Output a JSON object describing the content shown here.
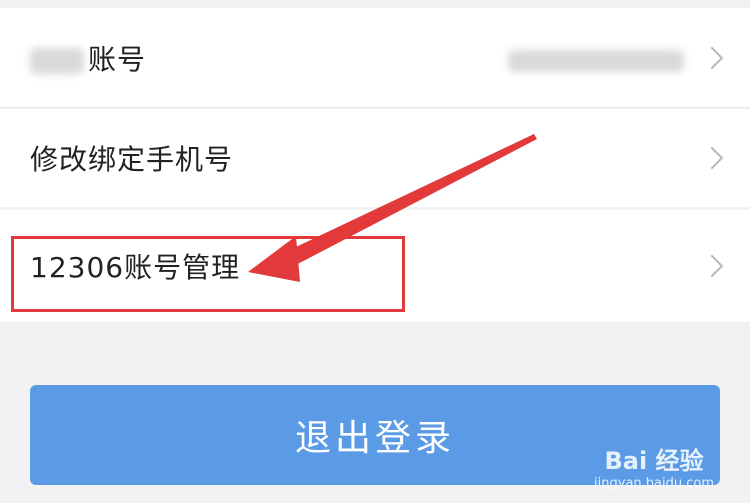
{
  "rows": [
    {
      "label": "账号"
    },
    {
      "label": "修改绑定手机号"
    },
    {
      "label": "12306账号管理"
    }
  ],
  "logout": {
    "label": "退出登录"
  },
  "watermark": {
    "brand": "Bai 经验",
    "site": "jingyan.baidu.com"
  },
  "colors": {
    "accent": "#5b9be5",
    "annotation": "#e23a3a"
  },
  "icons": {
    "row_arrow": "chevron-right-icon"
  }
}
